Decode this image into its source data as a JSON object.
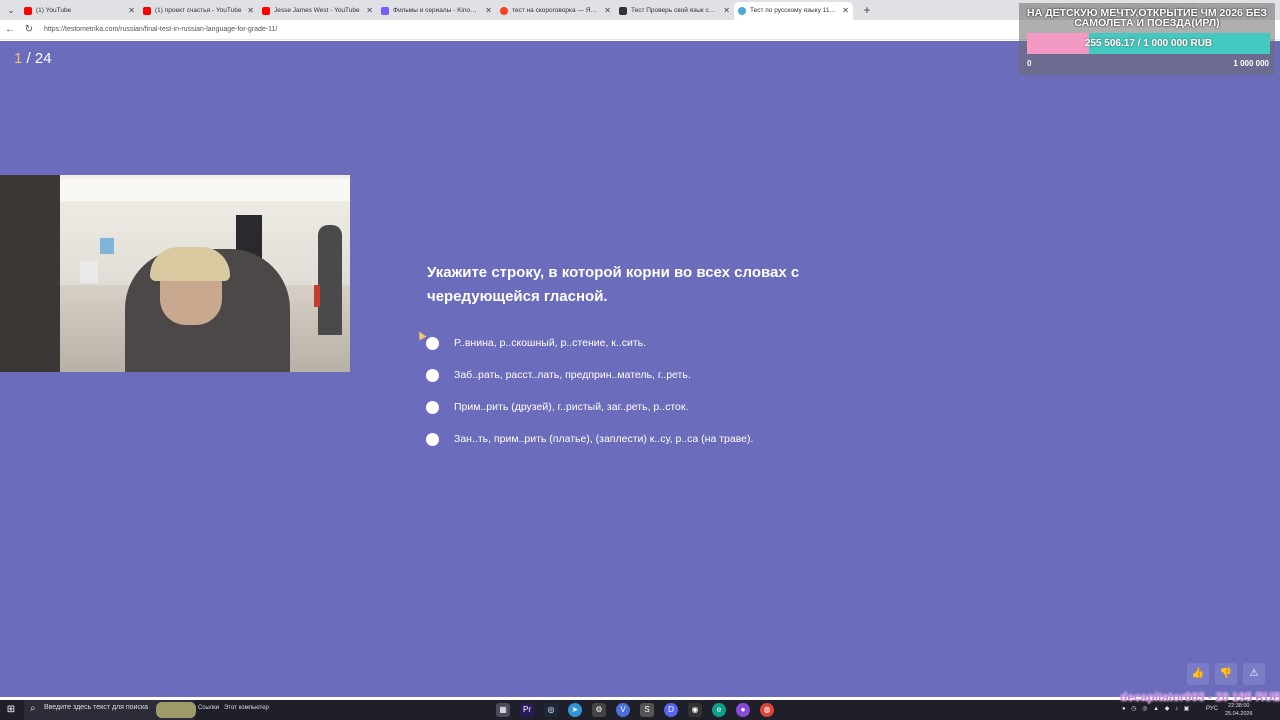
{
  "browser": {
    "tabs": [
      {
        "label": "(1) YouTube",
        "color": "#ff0000"
      },
      {
        "label": "(1) проект счастья - YouTube",
        "color": "#ff0000"
      },
      {
        "label": "Jesse James West - YouTube",
        "color": "#ff0000"
      },
      {
        "label": "Фильмы и сериалы - Kinobox.in",
        "color": "#7b5cff"
      },
      {
        "label": "тест на скороговорка — Яндекс",
        "color": "#fc3f1d"
      },
      {
        "label": "Тест Проверь свой язык скорог",
        "color": "#333333"
      },
      {
        "label": "Тест по русскому языку 11 класс",
        "color": "#4aa8d8"
      }
    ],
    "url": "https://testometrika.com/russian/final-test-in-russian-language-for-grade-11/"
  },
  "quiz": {
    "current": "1",
    "total": "/ 24",
    "question": "Укажите строку, в которой корни во всех словах с чередующейся гласной.",
    "answers": [
      "Р..внина, р..скошный, р..стение, к..сить.",
      "Заб..рать, расст..лать, предприн..матель, г..реть.",
      "Прим..рить (друзей), г..ристый, заг..реть, р..сток.",
      "Зан..ть, прим..рить (платье), (заплести) к..су, р..са (на траве)."
    ]
  },
  "overlay": {
    "goal_title": "НА ДЕТСКУЮ МЕЧТУ,ОТКРЫТИЕ ЧМ 2026 БЕЗ САМОЛЕТА И ПОЕЗДА(ИРЛ)",
    "goal_amount": "255 506.17 / 1 000 000 RUB",
    "goal_progress": 0.2555,
    "goal_min": "0",
    "goal_max": "1 000 000",
    "donation": "decapitator003 - 20 195 RUB"
  },
  "taskbar": {
    "search_placeholder": "Введите здесь текст для поиска",
    "links": "Ссылки",
    "pc": "Этот компьютер",
    "lang": "РУС",
    "time": "22:38:00",
    "date": "25.04.2026"
  }
}
